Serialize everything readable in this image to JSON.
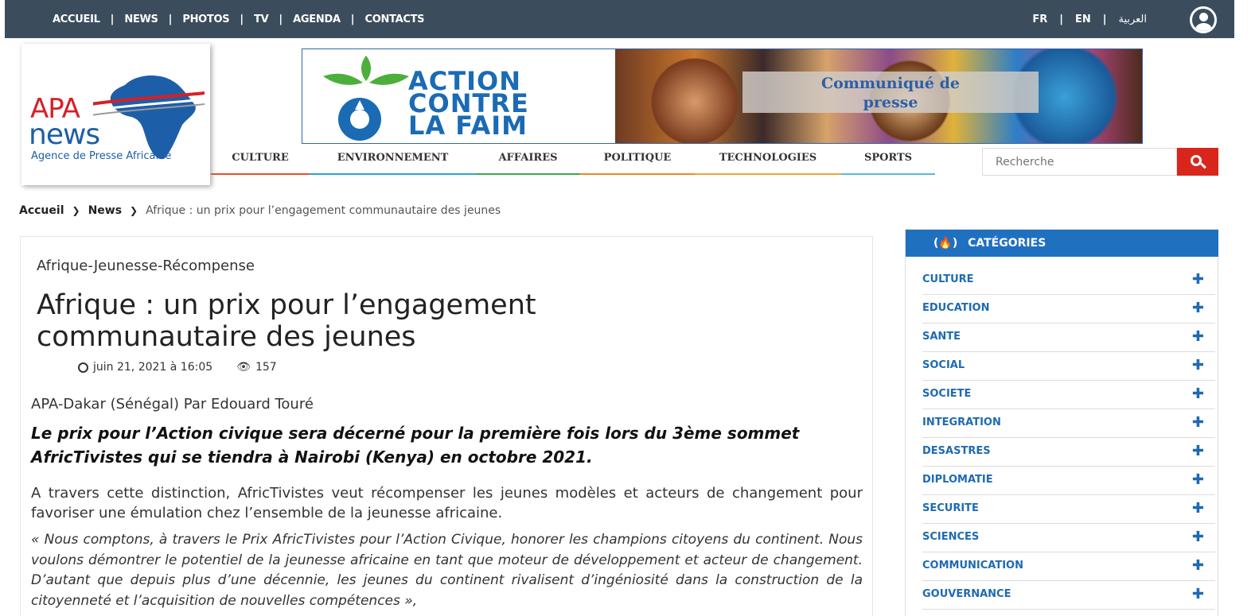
{
  "topnav": [
    "ACCUEIL",
    "NEWS",
    "PHOTOS",
    "TV",
    "AGENDA",
    "CONTACTS"
  ],
  "languages": {
    "fr": "FR",
    "en": "EN",
    "ar": "العربية"
  },
  "logo": {
    "apa": "APA",
    "news": "news",
    "tagline": "Agence de Presse Africaine"
  },
  "banner": {
    "org_lines": [
      "ACTION",
      "CONTRE",
      "LA FAIM"
    ],
    "communique": [
      "Communiqué de",
      "presse"
    ]
  },
  "categories_nav": [
    {
      "label": "CULTURE",
      "color": "#e2502a"
    },
    {
      "label": "ENVIRONNEMENT",
      "color": "#2aa6c8"
    },
    {
      "label": "AFFAIRES",
      "color": "#3aa84a"
    },
    {
      "label": "POLITIQUE",
      "color": "#e88a2a"
    },
    {
      "label": "TECHNOLOGIES",
      "color": "#e8a83a"
    },
    {
      "label": "SPORTS",
      "color": "#5ab8d8"
    }
  ],
  "search": {
    "placeholder": "Recherche"
  },
  "breadcrumb": {
    "home": "Accueil",
    "section": "News",
    "current": "Afrique : un prix pour l’engagement communautaire des jeunes"
  },
  "article": {
    "kicker": "Afrique-Jeunesse-Récompense",
    "title": "Afrique : un prix pour l’engagement communautaire des jeunes",
    "date": "juin 21, 2021 à 16:05",
    "views": "157",
    "byline": "APA-Dakar (Sénégal) Par Edouard Touré",
    "lead": "Le prix pour l’Action civique sera décerné pour la première fois lors du 3ème sommet AfricTivistes qui se tiendra à Nairobi (Kenya) en octobre 2021.",
    "p1": "A travers cette distinction, AfricTivistes veut récompenser les jeunes modèles et acteurs de changement pour favoriser une émulation chez l’ensemble de la jeunesse africaine.",
    "p2": "« Nous comptons, à travers le Prix AfricTivistes pour l’Action Civique, honorer les champions citoyens du continent. Nous voulons démontrer le potentiel de la jeunesse africaine en tant que moteur de développement et acteur de changement. D’autant que depuis plus d’une décennie, les jeunes du continent rivalisent d’ingéniosité dans la construction de la citoyenneté et l’acquisition de nouvelles compétences »,"
  },
  "sidebar": {
    "title": "CATÉGORIES",
    "items": [
      "CULTURE",
      "EDUCATION",
      "SANTE",
      "SOCIAL",
      "SOCIETE",
      "INTEGRATION",
      "DESASTRES",
      "DIPLOMATIE",
      "SECURITE",
      "SCIENCES",
      "COMMUNICATION",
      "GOUVERNANCE"
    ]
  },
  "colors": {
    "topbar": "#3b4d5c",
    "accent_blue": "#1e6ab3",
    "search_red": "#d9261c"
  }
}
